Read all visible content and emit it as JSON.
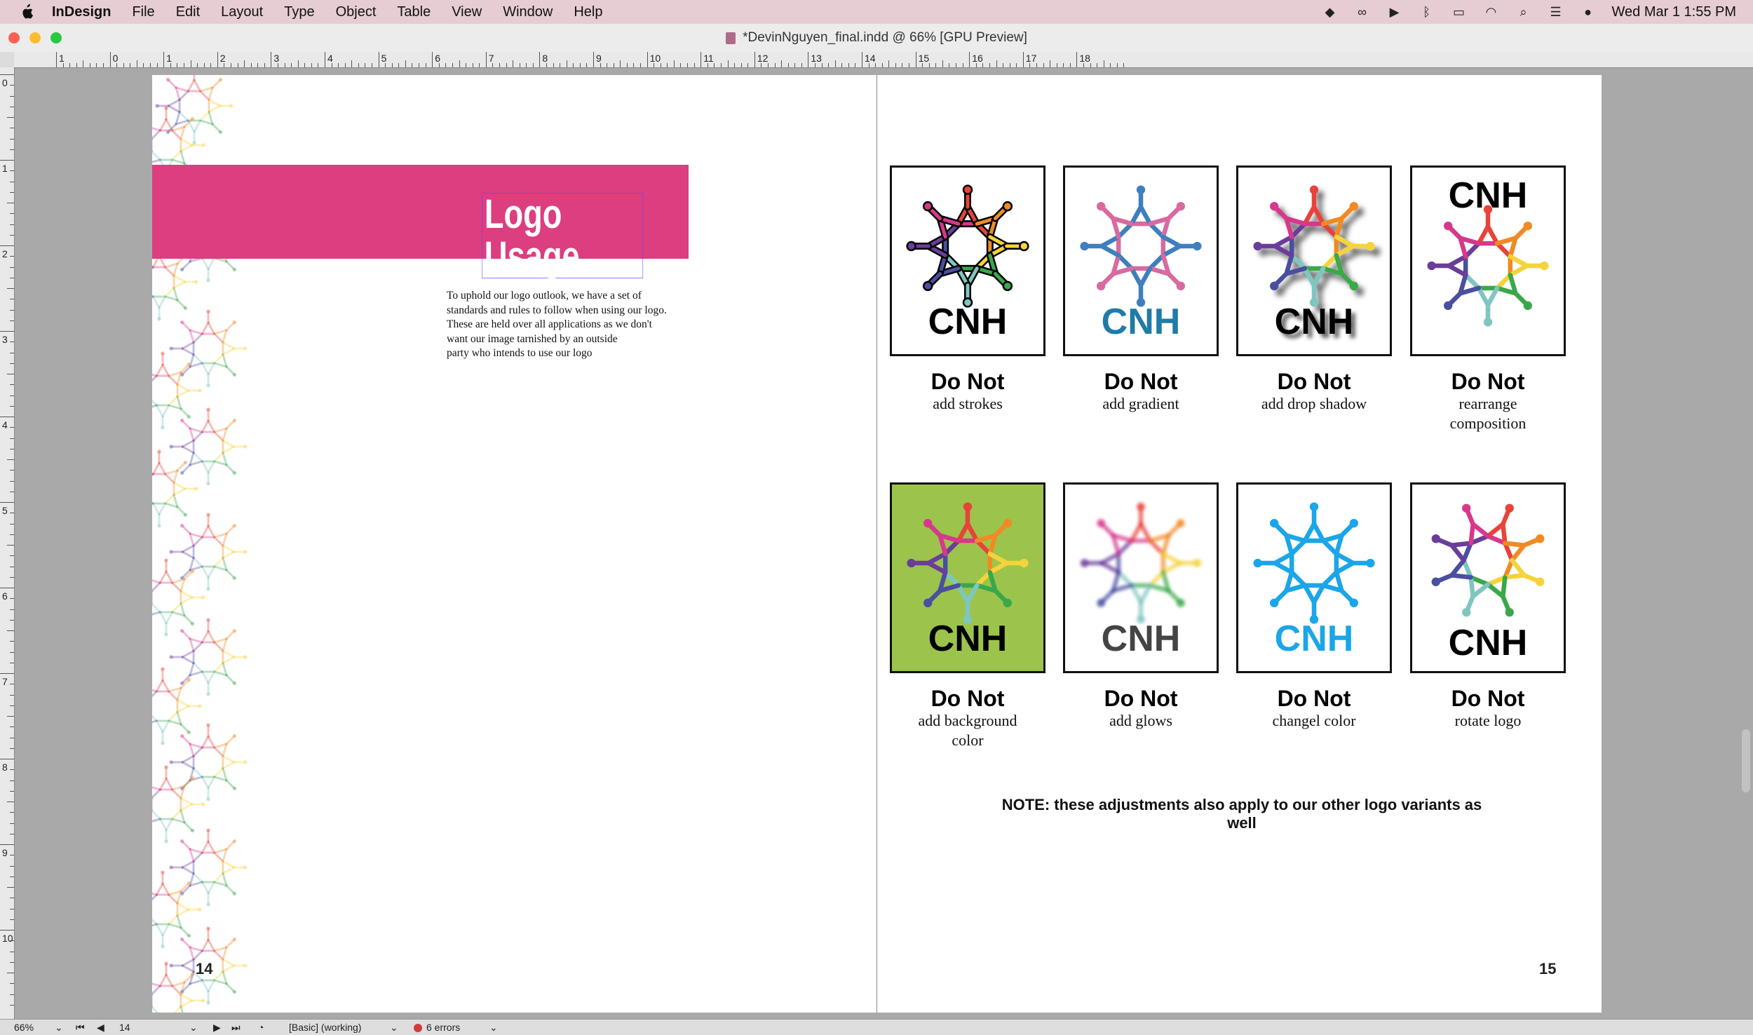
{
  "menubar": {
    "app": "InDesign",
    "items": [
      "File",
      "Edit",
      "Layout",
      "Type",
      "Object",
      "Table",
      "View",
      "Window",
      "Help"
    ],
    "datetime": "Wed Mar 1  1:55 PM",
    "tray_icons": [
      "dropbox-icon",
      "creative-cloud-icon",
      "play-icon",
      "bluetooth-icon",
      "battery-icon",
      "wifi-icon",
      "search-icon",
      "control-center-icon",
      "siri-icon"
    ]
  },
  "window": {
    "title": "*DevinNguyen_final.indd @ 66% [GPU Preview]",
    "traffic_colors": [
      "#ff5f57",
      "#febc2e",
      "#28c840"
    ]
  },
  "rulers": {
    "horizontal": [
      "1",
      "0",
      "1",
      "2",
      "3",
      "4",
      "5",
      "6",
      "7",
      "8",
      "9",
      "10",
      "11",
      "12",
      "13",
      "14",
      "15",
      "16",
      "17",
      "18"
    ],
    "vertical": [
      "0",
      "1",
      "2",
      "3",
      "4",
      "5",
      "6",
      "7",
      "8",
      "9",
      "10"
    ]
  },
  "left_page": {
    "heading": "Logo Usage",
    "intro_lines": [
      "To uphold our logo outlook, we have a set of",
      "standards and rules to follow when using our logo.",
      "These are held over all applications as we don't",
      "want our image tarnished by an outside",
      "party who intends to use our logo"
    ],
    "page_number": "14",
    "banner_color": "#dc3e7f"
  },
  "right_page": {
    "page_number": "15",
    "cards": [
      {
        "title": "Do Not",
        "sub": [
          "add strokes"
        ],
        "mark": "CNH",
        "variant": "strokes"
      },
      {
        "title": "Do Not",
        "sub": [
          "add gradient"
        ],
        "mark": "CNH",
        "variant": "gradient"
      },
      {
        "title": "Do Not",
        "sub": [
          "add drop shadow"
        ],
        "mark": "CNH",
        "variant": "shadow"
      },
      {
        "title": "Do Not",
        "sub": [
          "rearrange",
          "composition"
        ],
        "mark": "CNH",
        "variant": "rearrange"
      },
      {
        "title": "Do Not",
        "sub": [
          "add background",
          "color"
        ],
        "mark": "CNH",
        "variant": "background"
      },
      {
        "title": "Do Not",
        "sub": [
          "add glows"
        ],
        "mark": "CNH",
        "variant": "glow"
      },
      {
        "title": "Do Not",
        "sub": [
          "changel color"
        ],
        "mark": "CNH",
        "variant": "color"
      },
      {
        "title": "Do Not",
        "sub": [
          "rotate logo"
        ],
        "mark": "CNH",
        "variant": "rotate"
      }
    ],
    "note": "NOTE: these adjustments also apply to our other logo variants as well"
  },
  "statusbar": {
    "zoom": "66%",
    "page": "14",
    "style": "[Basic] (working)",
    "errors": "6 errors"
  },
  "colors": {
    "logo_spectrum": [
      "#e8433a",
      "#f08a24",
      "#f5d33a",
      "#3aa84a",
      "#7fc6c0",
      "#4a4fa0",
      "#6a3d9a",
      "#d6398b"
    ],
    "gradient_logo": [
      "#3f7fbf",
      "#d86aa0"
    ],
    "cyan_logo": "#1aa6e8",
    "green_background": "#9cc44c"
  }
}
